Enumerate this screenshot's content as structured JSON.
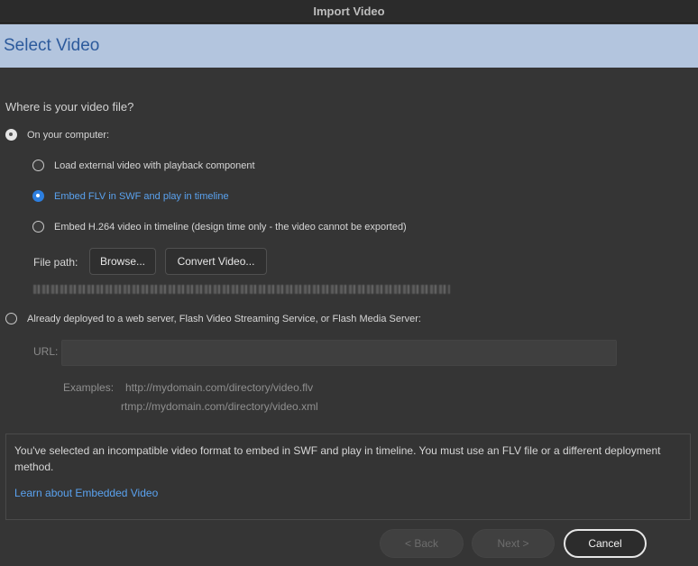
{
  "window": {
    "title": "Import Video"
  },
  "header": {
    "title": "Select Video"
  },
  "question": "Where is your video file?",
  "source_options": {
    "computer": {
      "label": "On your computer:",
      "selected": true
    },
    "deployed": {
      "label": "Already deployed to a web server, Flash Video Streaming Service, or Flash Media Server:",
      "selected": false
    }
  },
  "embed_options": [
    {
      "label": "Load external video with playback component",
      "selected": false
    },
    {
      "label": "Embed FLV in SWF and play in timeline",
      "selected": true
    },
    {
      "label": "Embed H.264 video in timeline (design time only - the video cannot be exported)",
      "selected": false
    }
  ],
  "file_path": {
    "label": "File path:",
    "browse_label": "Browse...",
    "convert_label": "Convert Video..."
  },
  "url": {
    "label": "URL:",
    "value": ""
  },
  "examples": {
    "label": "Examples:",
    "items": [
      "http://mydomain.com/directory/video.flv",
      "rtmp://mydomain.com/directory/video.xml"
    ]
  },
  "info": {
    "message": "You've selected an incompatible video format to embed in SWF and play in timeline. You must use an FLV file or a different deployment method.",
    "link": "Learn about Embedded Video"
  },
  "footer": {
    "back_label": "< Back",
    "next_label": "Next >",
    "cancel_label": "Cancel"
  },
  "colors": {
    "accent": "#2d7fe0",
    "link": "#5aa2ef",
    "header_band": "#b3c5de",
    "header_text": "#2c5a9c",
    "background": "#353535"
  }
}
